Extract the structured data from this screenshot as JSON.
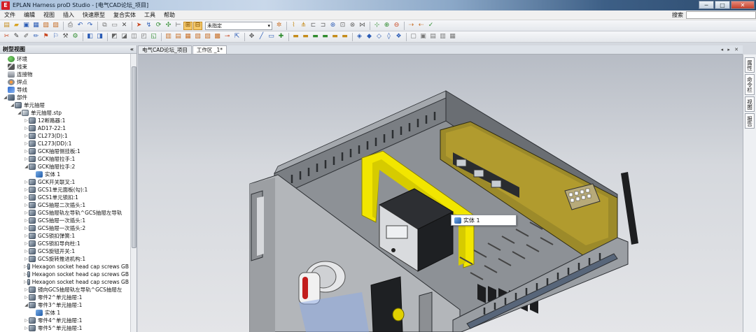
{
  "window": {
    "logo": "E",
    "title": "EPLAN Harness proD Studio - [电气CAD论坛_项目]",
    "minimize": "─",
    "maximize": "□",
    "close": "✕"
  },
  "menu": [
    "文件",
    "编辑",
    "视图",
    "插入",
    "快速原型",
    "复合实体",
    "工具",
    "帮助"
  ],
  "search": {
    "label": "搜索",
    "value": ""
  },
  "toolbar1": {
    "layer_select": "未指定",
    "layer_arrow": "▾"
  },
  "tree": {
    "header": "树型视图",
    "collapse": "«",
    "items": [
      {
        "label": "环境",
        "level": 1,
        "icon": "ic-env",
        "exp": ""
      },
      {
        "label": "线束",
        "level": 1,
        "icon": "ic-wire",
        "exp": ""
      },
      {
        "label": "连接物",
        "level": 1,
        "icon": "ic-conn",
        "exp": ""
      },
      {
        "label": "焊点",
        "level": 1,
        "icon": "ic-solder",
        "exp": ""
      },
      {
        "label": "导线",
        "level": 1,
        "icon": "ic-guide",
        "exp": ""
      },
      {
        "label": "部件",
        "level": 1,
        "icon": "ic-part",
        "exp": "◢"
      },
      {
        "label": "单元抽屉",
        "level": 2,
        "icon": "ic-asm",
        "exp": "◢"
      },
      {
        "label": "单元抽屉.stp",
        "level": 3,
        "icon": "ic-file",
        "exp": "◢"
      },
      {
        "label": "12断路器:1",
        "level": 4,
        "icon": "ic-asm",
        "exp": "▷"
      },
      {
        "label": "AD17-22:1",
        "level": 4,
        "icon": "ic-asm",
        "exp": "▷"
      },
      {
        "label": "CL273(D):1",
        "level": 4,
        "icon": "ic-asm",
        "exp": "▷"
      },
      {
        "label": "CL273(DD):1",
        "level": 4,
        "icon": "ic-asm",
        "exp": "▷"
      },
      {
        "label": "GCK抽屉侧挂板:1",
        "level": 4,
        "icon": "ic-asm",
        "exp": "▷"
      },
      {
        "label": "GCK抽屉拉手:1",
        "level": 4,
        "icon": "ic-asm",
        "exp": "▷"
      },
      {
        "label": "GCK抽屉拉手:2",
        "level": 4,
        "icon": "ic-asm",
        "exp": "◢"
      },
      {
        "label": "实体 1",
        "level": 5,
        "icon": "ic-body",
        "exp": ""
      },
      {
        "label": "GCK开关联叉:1",
        "level": 4,
        "icon": "ic-asm",
        "exp": "▷"
      },
      {
        "label": "GCS1单元面板(勾):1",
        "level": 4,
        "icon": "ic-asm",
        "exp": "▷"
      },
      {
        "label": "GCS1单元锁扣:1",
        "level": 4,
        "icon": "ic-asm",
        "exp": "▷"
      },
      {
        "label": "GCS抽屉二次插头:1",
        "level": 4,
        "icon": "ic-asm",
        "exp": "▷"
      },
      {
        "label": "GCS抽屉轨左导轨^GCS抽屉左导轨",
        "level": 4,
        "icon": "ic-asm",
        "exp": "▷"
      },
      {
        "label": "GCS抽屉一次插头:1",
        "level": 4,
        "icon": "ic-asm",
        "exp": "▷"
      },
      {
        "label": "GCS抽屉一次插头:2",
        "level": 4,
        "icon": "ic-asm",
        "exp": "▷"
      },
      {
        "label": "GCS锁扣弹簧:1",
        "level": 4,
        "icon": "ic-asm",
        "exp": "▷"
      },
      {
        "label": "GCS锁扣导向柱:1",
        "level": 4,
        "icon": "ic-asm",
        "exp": "▷"
      },
      {
        "label": "GCS旋钮开关:1",
        "level": 4,
        "icon": "ic-asm",
        "exp": "▷"
      },
      {
        "label": "GCS旋转推进机构:1",
        "level": 4,
        "icon": "ic-asm",
        "exp": "▷"
      },
      {
        "label": "Hexagon socket head cap screws GB",
        "level": 4,
        "icon": "ic-asm",
        "exp": "▷"
      },
      {
        "label": "Hexagon socket head cap screws GB",
        "level": 4,
        "icon": "ic-asm",
        "exp": "▷"
      },
      {
        "label": "Hexagon socket head cap screws GB",
        "level": 4,
        "icon": "ic-asm",
        "exp": "▷"
      },
      {
        "label": "镜向GCS抽屉轨左导轨^GCS抽屉左",
        "level": 4,
        "icon": "ic-asm",
        "exp": "▷"
      },
      {
        "label": "零件2^单元抽屉:1",
        "level": 4,
        "icon": "ic-asm",
        "exp": "▷"
      },
      {
        "label": "零件3^单元抽屉:1",
        "level": 4,
        "icon": "ic-asm",
        "exp": "◢"
      },
      {
        "label": "实体 1",
        "level": 5,
        "icon": "ic-body",
        "exp": ""
      },
      {
        "label": "零件4^单元抽屉:1",
        "level": 4,
        "icon": "ic-asm",
        "exp": "▷"
      },
      {
        "label": "零件5^单元抽屉:1",
        "level": 4,
        "icon": "ic-asm",
        "exp": "▷"
      }
    ]
  },
  "tabs": [
    {
      "label": "电气CAD论坛_项目"
    },
    {
      "label": "工作区 _1*"
    }
  ],
  "tab_nav": "◂ ▸ ✕",
  "dock": [
    "属性",
    "命令栏",
    "视图",
    "报告"
  ],
  "tooltip": {
    "label": "实体 1"
  },
  "colors": {
    "highlight": "#f2e600",
    "title_close": "#c2412c",
    "accent": "#f5c96b"
  }
}
